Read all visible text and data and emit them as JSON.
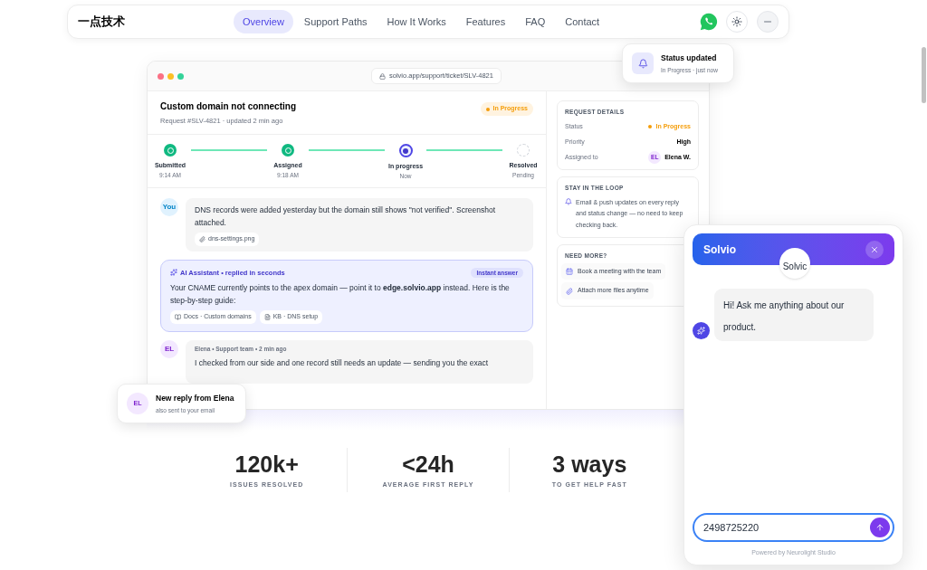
{
  "nav": {
    "logo": "一点技术",
    "links": [
      {
        "label": "Overview",
        "selected": true
      },
      {
        "label": "Support Paths",
        "selected": false
      },
      {
        "label": "How It Works",
        "selected": false
      },
      {
        "label": "Features",
        "selected": false
      },
      {
        "label": "FAQ",
        "selected": false
      },
      {
        "label": "Contact",
        "selected": false
      }
    ]
  },
  "ticket": {
    "url": "solvio.app/support/ticket/SLV-4821",
    "title": "Custom domain not connecting",
    "subtitle": "Request #SLV-4821 · updated 2 min ago",
    "status": "In Progress",
    "steps": [
      {
        "label": "Submitted",
        "time": "9:14 AM",
        "kind": "done"
      },
      {
        "label": "Assigned",
        "time": "9:18 AM",
        "kind": "done"
      },
      {
        "label": "In progress",
        "time": "Now",
        "kind": "current"
      },
      {
        "label": "Resolved",
        "time": "Pending",
        "kind": "pending"
      }
    ],
    "messages": [
      {
        "kind": "user",
        "avatar": "You",
        "text": "DNS records were added yesterday but the domain still shows \"not verified\". Screenshot attached.",
        "attachments": [
          "dns-settings.png"
        ]
      },
      {
        "kind": "ai",
        "header": "AI Assistant • replied in seconds",
        "badge": "Instant answer",
        "text": "Your CNAME currently points to the apex domain — point it to **edge.solvio.app** instead. Here is the step-by-step guide:",
        "attachments": [
          "Docs · Custom domains",
          "KB · DNS setup"
        ]
      },
      {
        "kind": "agent",
        "avatar": "EL",
        "header": "Elena • Support team • 2 min ago",
        "text": "I checked from our side and one record still needs an update — sending you the exact"
      }
    ],
    "details": {
      "heading": "REQUEST DETAILS",
      "rows": [
        {
          "label": "Status",
          "value": "In Progress",
          "kind": "status"
        },
        {
          "label": "Priority",
          "value": "High",
          "kind": "plain"
        },
        {
          "label": "Assigned to",
          "value": "Elena W.",
          "avatar": "EL",
          "kind": "person"
        }
      ]
    },
    "loop": {
      "heading": "STAY IN THE LOOP",
      "text": "Email & push updates on every reply and status change — no need to keep checking back."
    },
    "more": {
      "heading": "NEED MORE?",
      "items": [
        {
          "label": "Book a meeting with the team",
          "kind": "meeting"
        },
        {
          "label": "Attach more files anytime",
          "kind": "files"
        }
      ]
    }
  },
  "toasts": [
    {
      "title": "Status updated",
      "subtitle": "In Progress · just now",
      "kind": "status"
    },
    {
      "title": "New reply from Elena",
      "subtitle": "also sent to your email",
      "kind": "reply",
      "avatar": "EL"
    }
  ],
  "stats": [
    {
      "value": "120k+",
      "label": "ISSUES RESOLVED"
    },
    {
      "value": "<24h",
      "label": "AVERAGE FIRST REPLY"
    },
    {
      "value": "3 ways",
      "label": "TO GET HELP FAST"
    }
  ],
  "chat": {
    "title": "Solvio",
    "logo_alt": "Solvic",
    "greeting": "Hi! Ask me anything about our product.",
    "input_value": "2498725220",
    "footer": "Powered by Neurolight Studio"
  }
}
